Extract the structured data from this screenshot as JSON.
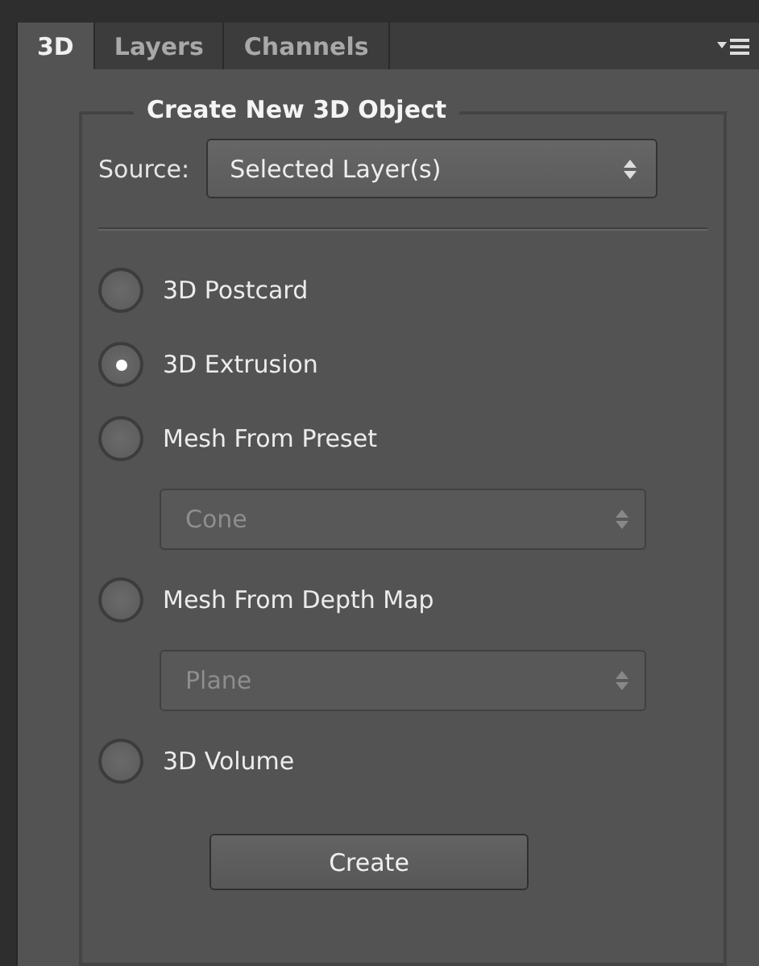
{
  "tabs": [
    {
      "label": "3D",
      "selected": true
    },
    {
      "label": "Layers",
      "selected": false
    },
    {
      "label": "Channels",
      "selected": false
    }
  ],
  "group": {
    "title": "Create New 3D Object",
    "source": {
      "label": "Source:",
      "value": "Selected Layer(s)"
    },
    "items": [
      {
        "kind": "radio",
        "label": "3D Postcard",
        "selected": false
      },
      {
        "kind": "radio",
        "label": "3D Extrusion",
        "selected": true
      },
      {
        "kind": "radio",
        "label": "Mesh From Preset",
        "selected": false
      },
      {
        "kind": "select",
        "value": "Cone",
        "disabled": true
      },
      {
        "kind": "radio",
        "label": "Mesh From Depth Map",
        "selected": false
      },
      {
        "kind": "select",
        "value": "Plane",
        "disabled": true
      },
      {
        "kind": "radio",
        "label": "3D Volume",
        "selected": false
      }
    ],
    "button": "Create"
  }
}
